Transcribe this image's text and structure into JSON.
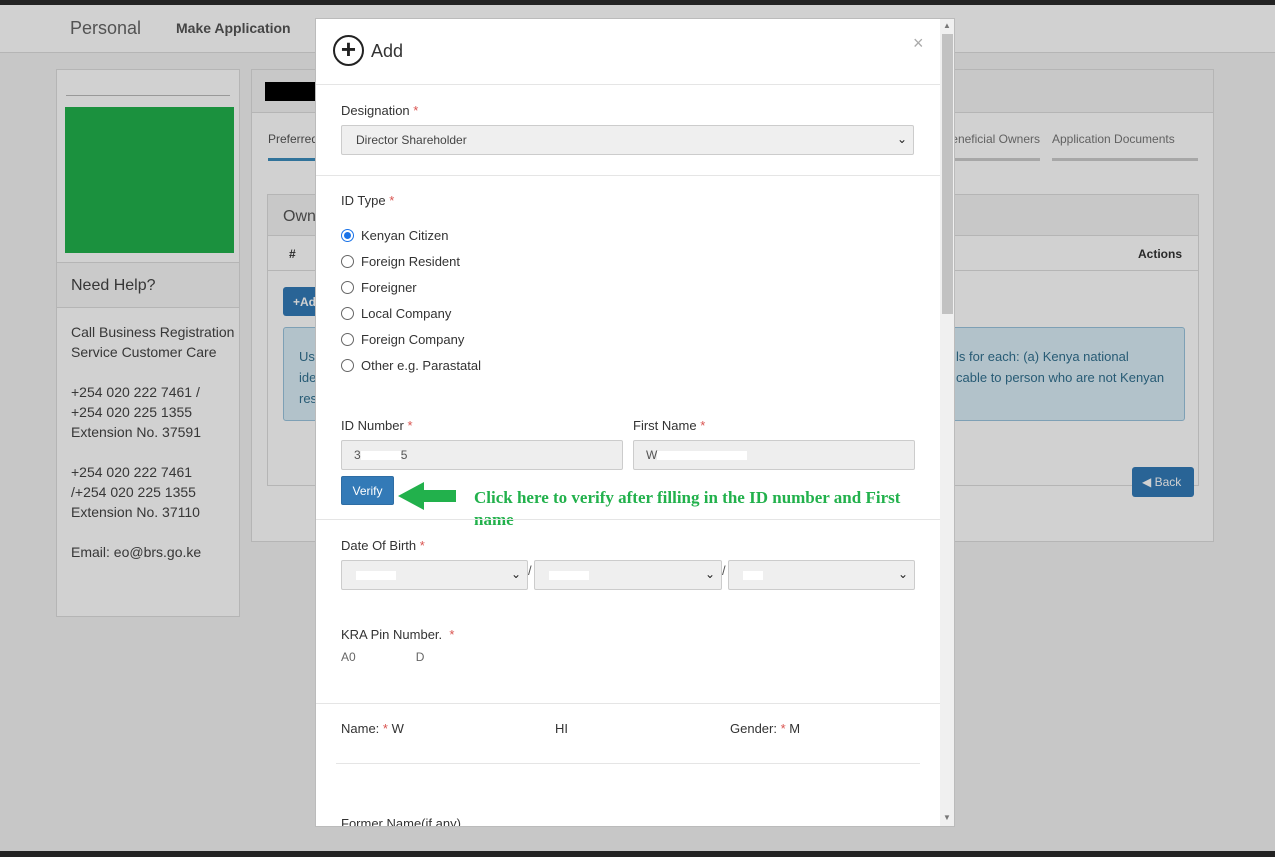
{
  "nav": {
    "brand": "Personal",
    "link": "Make Application"
  },
  "sidebar": {
    "help_title": "Need Help?",
    "call_text": "Call Business Registration Service Customer Care",
    "phones_1": [
      "+254 020 222 7461 /",
      "+254 020 225 1355",
      "Extension No. 37591"
    ],
    "phones_2": [
      "+254 020 222 7461",
      "/+254 020 225 1355",
      "Extension No. 37110"
    ],
    "email": "Email: eo@brs.go.ke"
  },
  "main": {
    "tab_preferred": "Preferred",
    "tab_beneficial": "Beneficial Owners",
    "tab_documents": "Application Documents",
    "owners_title": "Own",
    "th_hash": "#",
    "th_actions": "Actions",
    "add_label": "+Ad",
    "info_left": [
      "Use",
      "ide",
      "res"
    ],
    "info_right": [
      "ls for each: (a) Kenya national",
      "cable to person who are not Kenyan"
    ],
    "back_label": "Back",
    "colors": {
      "primary": "#337ab7",
      "info_bg": "#d9edf7",
      "green": "#22b14c"
    }
  },
  "modal": {
    "title": "Add",
    "close": "×",
    "designation": {
      "label": "Designation",
      "value": "Director Shareholder"
    },
    "id_type": {
      "label": "ID Type",
      "options": [
        "Kenyan Citizen",
        "Foreign Resident",
        "Foreigner",
        "Local Company",
        "Foreign Company",
        "Other e.g. Parastatal"
      ],
      "selected": "Kenyan Citizen"
    },
    "id_number": {
      "label": "ID Number",
      "value_start": "3",
      "value_end": "5"
    },
    "first_name": {
      "label": "First Name",
      "value_start": "W"
    },
    "verify_label": "Verify",
    "annotation": "Click here to verify after filling in the ID number and First name",
    "dob": {
      "label": "Date Of Birth",
      "separator": "/"
    },
    "kra": {
      "label": "KRA Pin Number.",
      "value_start": "A0",
      "value_end": "D"
    },
    "name": {
      "label": "Name:",
      "value_start": "W",
      "value_mid": "HI"
    },
    "gender": {
      "label": "Gender:",
      "value": "M"
    },
    "former_name": {
      "label": "Former Name(if any)"
    },
    "required_mark": "*"
  }
}
